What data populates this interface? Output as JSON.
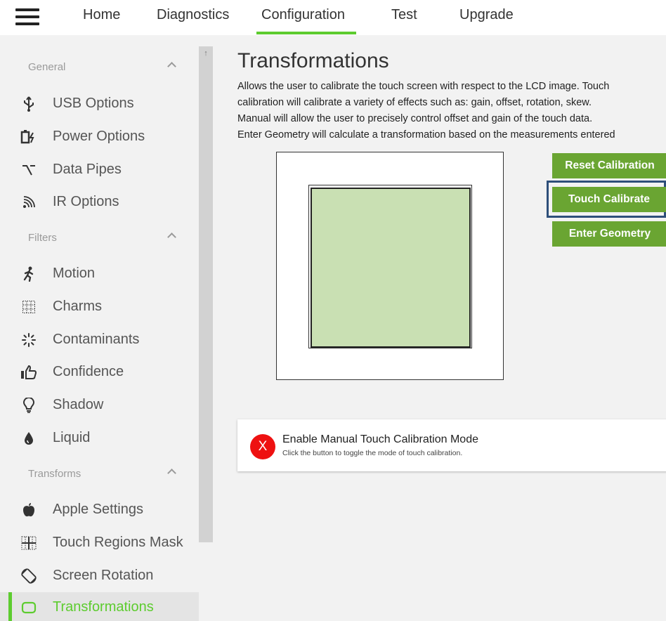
{
  "nav": {
    "tabs": [
      {
        "label": "Home"
      },
      {
        "label": "Diagnostics"
      },
      {
        "label": "Configuration"
      },
      {
        "label": "Test"
      },
      {
        "label": "Upgrade"
      }
    ],
    "active_tab": "Configuration"
  },
  "sidebar": {
    "sections": [
      {
        "header": "General",
        "items": [
          {
            "label": "USB Options",
            "icon": "usb-icon"
          },
          {
            "label": "Power Options",
            "icon": "battery-charging-icon"
          },
          {
            "label": "Data Pipes",
            "icon": "pipe-icon"
          },
          {
            "label": "IR Options",
            "icon": "rss-icon"
          }
        ]
      },
      {
        "header": "Filters",
        "items": [
          {
            "label": "Motion",
            "icon": "running-icon"
          },
          {
            "label": "Charms",
            "icon": "dotted-grid-icon"
          },
          {
            "label": "Contaminants",
            "icon": "spinner-icon"
          },
          {
            "label": "Confidence",
            "icon": "thumbs-up-icon"
          },
          {
            "label": "Shadow",
            "icon": "lightbulb-icon"
          },
          {
            "label": "Liquid",
            "icon": "droplet-icon"
          }
        ]
      },
      {
        "header": "Transforms",
        "items": [
          {
            "label": "Apple Settings",
            "icon": "apple-icon"
          },
          {
            "label": "Touch Regions Mask",
            "icon": "regions-grid-icon"
          },
          {
            "label": "Screen Rotation",
            "icon": "rotate-icon"
          },
          {
            "label": "Transformations",
            "icon": "rounded-square-icon",
            "active": true
          }
        ]
      }
    ]
  },
  "main": {
    "title": "Transformations",
    "description_lines": [
      "Allows the user to calibrate the touch screen with respect to the LCD image. Touch",
      "calibration will calibrate a variety of effects such as: gain, offset, rotation, skew.",
      "Manual will allow the user to precisely control offset and gain of the touch data.",
      "Enter Geometry will calculate a transformation based on the measurements entered"
    ],
    "buttons": {
      "reset": "Reset Calibration",
      "touch": "Touch Calibrate",
      "geometry": "Enter Geometry"
    },
    "focused_button": "Touch Calibrate",
    "manual_mode": {
      "toggle_symbol": "X",
      "title": "Enable Manual Touch Calibration Mode",
      "subtitle": "Click the button to toggle the mode of touch calibration.",
      "enabled": false
    }
  },
  "colors": {
    "accent": "#5dcc2f",
    "button": "#6aa532",
    "focus": "#2e4f7a",
    "toggle_off": "#ee1111",
    "screen_fill": "#c9e0b3"
  }
}
